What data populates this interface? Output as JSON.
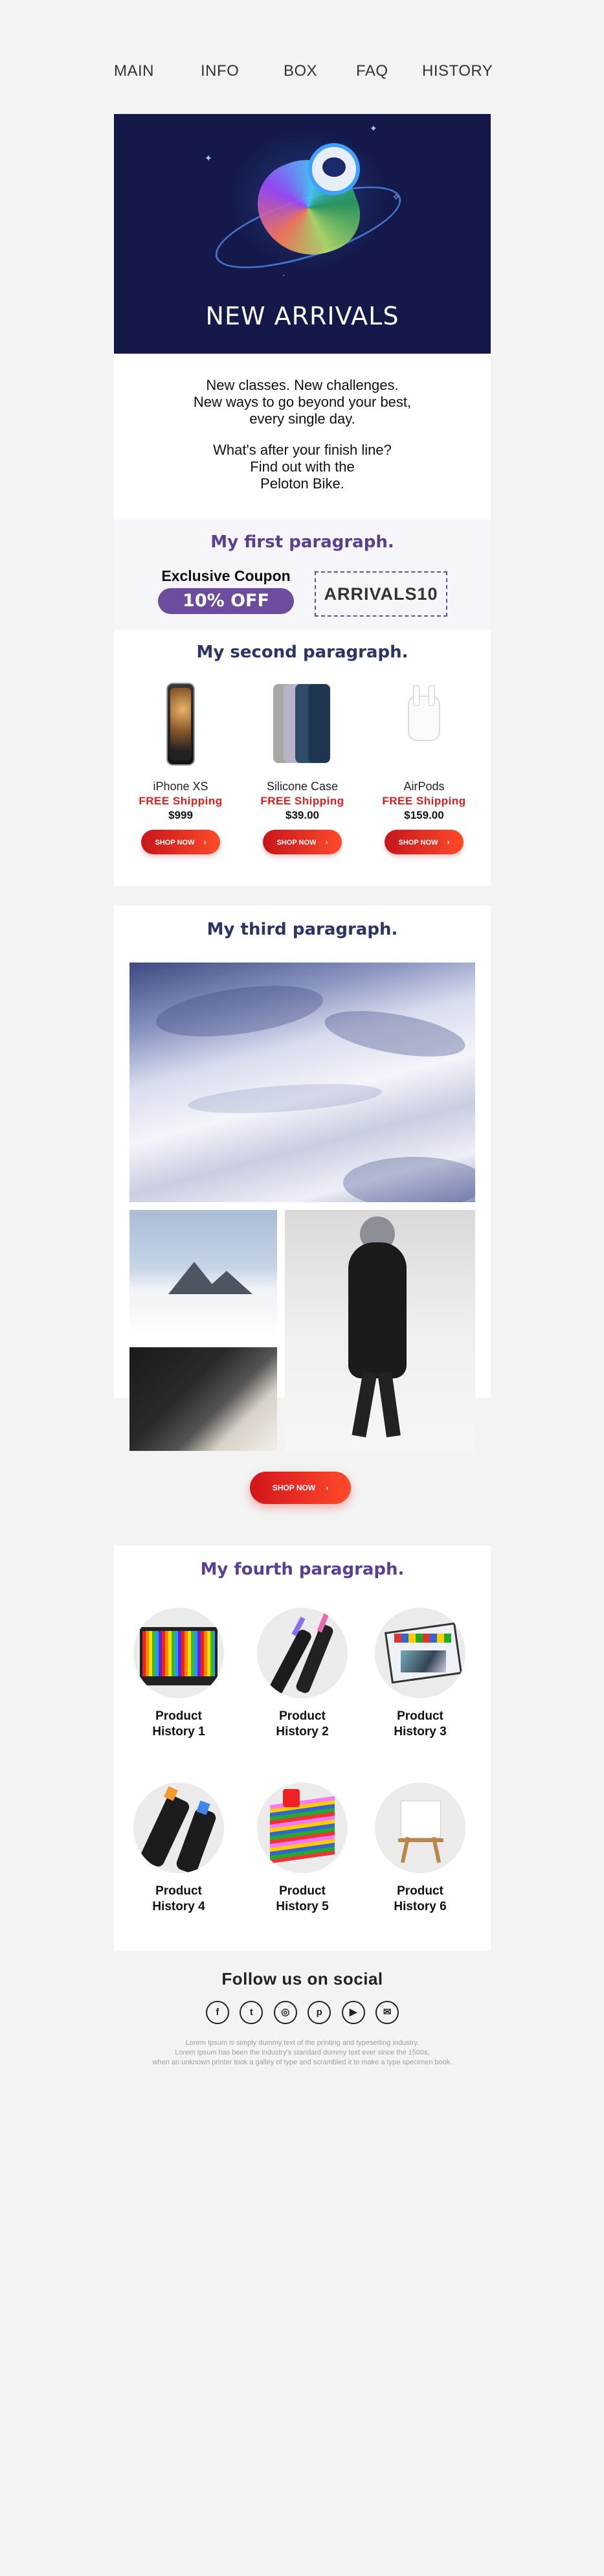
{
  "nav": {
    "items": [
      "MAIN",
      "INFO",
      "BOX",
      "FAQ",
      "HISTORY"
    ]
  },
  "hero": {
    "title": "NEW ARRIVALS"
  },
  "intro": {
    "lines1": [
      "New classes. New challenges.",
      "New ways to go beyond your best,",
      "every single day."
    ],
    "lines2": [
      "What's after your finish line?",
      "Find out with the",
      "Peloton Bike."
    ]
  },
  "coupon": {
    "title": "My first paragraph.",
    "label": "Exclusive Coupon",
    "discount": "10% OFF",
    "code": "ARRIVALS10"
  },
  "products": {
    "title": "My second paragraph.",
    "items": [
      {
        "name": "iPhone XS",
        "shipping": "FREE Shipping",
        "price": "$999",
        "button": "SHOP NOW"
      },
      {
        "name": "Silicone Case",
        "shipping": "FREE Shipping",
        "price": "$39.00",
        "button": "SHOP NOW"
      },
      {
        "name": "AirPods",
        "shipping": "FREE Shipping",
        "price": "$159.00",
        "button": "SHOP NOW"
      }
    ]
  },
  "gallery": {
    "title": "My third paragraph.",
    "button": "SHOP NOW"
  },
  "history": {
    "title": "My fourth paragraph.",
    "items": [
      {
        "line1": "Product",
        "line2": "History 1"
      },
      {
        "line1": "Product",
        "line2": "History 2"
      },
      {
        "line1": "Product",
        "line2": "History 3"
      },
      {
        "line1": "Product",
        "line2": "History 4"
      },
      {
        "line1": "Product",
        "line2": "History 5"
      },
      {
        "line1": "Product",
        "line2": "History 6"
      }
    ]
  },
  "social": {
    "title": "Follow us on social",
    "icons": [
      "facebook-icon",
      "twitter-icon",
      "instagram-icon",
      "pinterest-icon",
      "youtube-icon",
      "mail-icon"
    ],
    "lorem1": "Lorem Ipsum is simply dummy text of the printing and typesetting industry.",
    "lorem2": "Lorem Ipsum has been the industry's standard dummy text ever since the 1500s,",
    "lorem3": "when an unknown printer took a galley of type and scrambled it to make a type specimen book."
  },
  "colors": {
    "accent_purple": "#6b4c9f",
    "title_purple": "#5a3e93",
    "title_navy": "#2a3466",
    "shipping_red": "#e41b1b",
    "button_red": "#d3151d",
    "hero_bg": "#14194a",
    "page_bg": "#f3f3f3"
  }
}
